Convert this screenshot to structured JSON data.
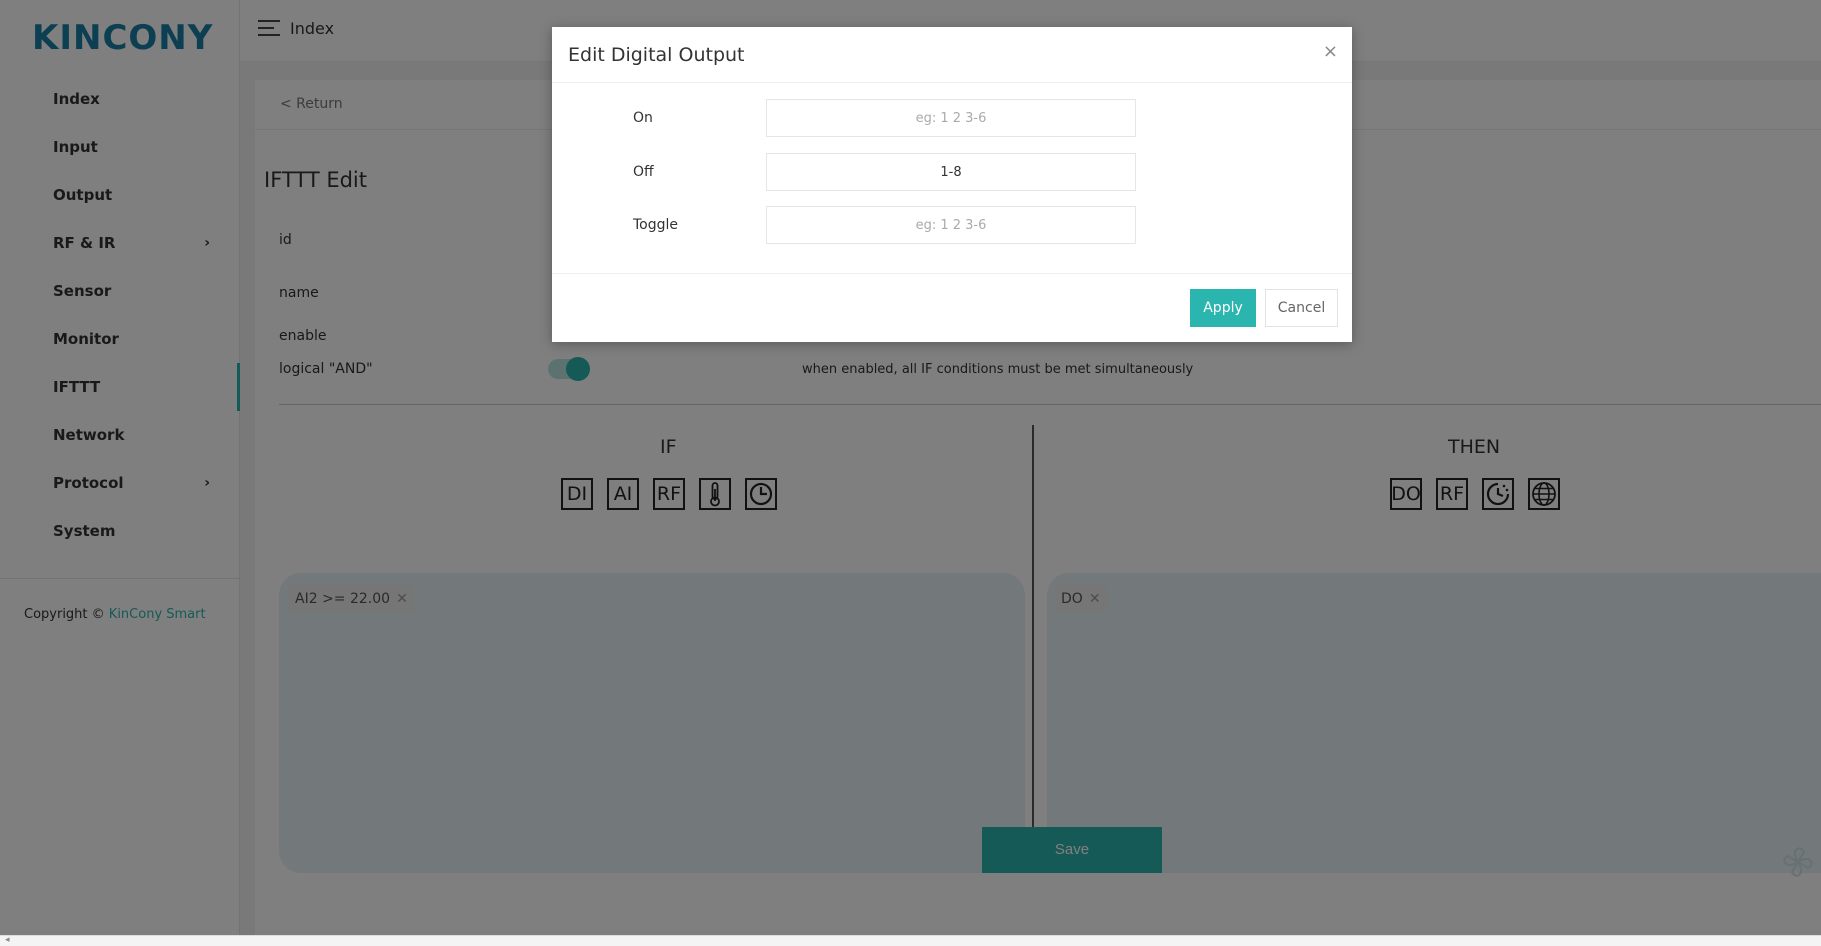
{
  "brand": {
    "logo_text": "KINCONY",
    "accent": "#2ab5ae",
    "logo_color": "#1a7fa6"
  },
  "header": {
    "title": "Index"
  },
  "sidebar": {
    "items": [
      {
        "label": "Index"
      },
      {
        "label": "Input"
      },
      {
        "label": "Output"
      },
      {
        "label": "RF & IR",
        "has_submenu": true
      },
      {
        "label": "Sensor"
      },
      {
        "label": "Monitor"
      },
      {
        "label": "IFTTT",
        "active": true
      },
      {
        "label": "Network"
      },
      {
        "label": "Protocol",
        "has_submenu": true
      },
      {
        "label": "System"
      }
    ],
    "copyright_prefix": "Copyright ©",
    "copyright_link": "KinCony Smart"
  },
  "page": {
    "return_label": "< Return",
    "title": "IFTTT Edit",
    "fields": {
      "id_label": "id",
      "name_label": "name",
      "enable_label": "enable",
      "logical_and_label": "logical \"AND\"",
      "logical_and_hint": "when enabled, all IF conditions must be met simultaneously"
    },
    "if_section": {
      "title": "IF",
      "buttons": [
        {
          "label": "DI",
          "icon": "di-icon"
        },
        {
          "label": "AI",
          "icon": "ai-icon"
        },
        {
          "label": "RF",
          "icon": "rf-icon"
        },
        {
          "label": "",
          "icon": "thermometer-icon"
        },
        {
          "label": "",
          "icon": "clock-icon"
        }
      ],
      "conditions": [
        {
          "text": "AI2 >= 22.00"
        }
      ]
    },
    "then_section": {
      "title": "THEN",
      "buttons": [
        {
          "label": "DO",
          "icon": "do-icon"
        },
        {
          "label": "RF",
          "icon": "rf-icon"
        },
        {
          "label": "",
          "icon": "delay-clock-icon"
        },
        {
          "label": "",
          "icon": "globe-icon"
        }
      ],
      "actions": [
        {
          "text": "DO"
        }
      ]
    },
    "save_label": "Save"
  },
  "modal": {
    "title": "Edit Digital Output",
    "close_glyph": "×",
    "fields": {
      "on": {
        "label": "On",
        "value": "",
        "placeholder": "eg: 1 2 3-6"
      },
      "off": {
        "label": "Off",
        "value": "1-8",
        "placeholder": "eg: 1 2 3-6"
      },
      "toggle": {
        "label": "Toggle",
        "value": "",
        "placeholder": "eg: 1 2 3-6"
      }
    },
    "apply_label": "Apply",
    "cancel_label": "Cancel"
  }
}
